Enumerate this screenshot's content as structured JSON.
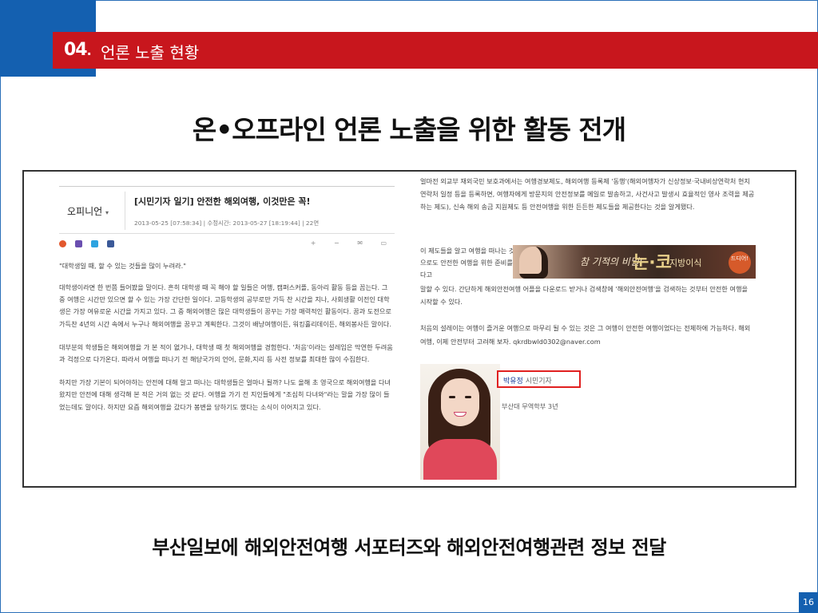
{
  "header": {
    "number": "04",
    "number_dot": ".",
    "title": "언론 노출 현황"
  },
  "main_title": "온•오프라인 언론 노출을 위한 활동 전개",
  "article": {
    "category": "오피니언",
    "category_caret": "▾",
    "title": "[시민기자 일기] 안전한 해외여행, 이것만은 꼭!",
    "meta": "2013-05-25 [07:58:34] | 수정시간: 2013-05-27 [18:19:44] | 22면",
    "tools": "+ − ✉ ▭",
    "quote": "\"대학생일 때, 할 수 있는 것들을 많이 누려라.\"",
    "para1": "대학생이라면 한 번쯤 들어봤을 말이다. 흔히 대학생 때 꼭 해야 할 일들은 여행, 캠퍼스커플, 동아리 활동 등을 꼽는다. 그 중 여행은 시간만 있으면 할 수 있는 가장 간단한 일이다. 고등학생의 공부로만 가득 찬 시간을 지나, 사회생활 이전인 대학생은 가장 여유로운 시간을 가지고 있다. 그 중 해외여행은 많은 대학생들이 꿈꾸는 가장 매력적인 활동이다. 꿈과 도전으로 가득찬 4년의 시간 속에서 누구나 해외여행을 꿈꾸고 계획한다. 그것이 배낭여행이든, 워킹홀리데이든, 해외봉사든 말이다.",
    "para2": "대부분의 학생들은 해외여행을 가 본 적이 없거나, 대학생 때 첫 해외여행을 경험한다. '처음'이라는 설레임은 막연한 두려움과 걱정으로 다가온다. 따라서 여행을 떠나기 전 해당국가의 언어, 문화,지리 등 사전 정보를 최대한 많이 수집한다.",
    "para3": "하지만 가장 기본이 되어야하는 안전에 대해 알고 떠나는 대학생들은 얼마나 될까? 나도 올해 초 영국으로 해외여행을 다녀왔지만 안전에 대해 생각해 본 적은 거의 없는 것 같다. 여행을 가기 전 지인들에게 \"조심히 다녀와\"라는 말을 가장 많이 들었는데도 말이다. 하지만 요즘 해외여행을 갔다가 봉변을 당하기도 했다는 소식이 이어지고 있다."
  },
  "right": {
    "para1": "얼마전 외교부 재외국민 보호과에서는 여행경보제도, 해외여행 등록제 '동행'(해외여행자가 신상정보·국내비상연락처 현지연락처 일정 등을 등록하면, 여행자에게 방문지의 안전정보를 메일로 발송하고, 사건사고 발생시 효율적인 영사 조력을 제공하는 제도), 신속 해외 송금 지원제도 등 안전여행을 위한 든든한 제도들을 제공한다는 것을 알게됐다.",
    "short": "이 제도들을 알고 여행을 떠나는 것만으로도 안전한 여행을 위한 준비를 했다고",
    "para2": "말할 수 있다. 간단하게 해외안전여행 어플을 다운로드 받거나 검색창에 '해외안전여행'을 검색하는 것부터 안전한 여행을 시작할 수 있다.",
    "para3": "처음의 설레이는 여행이 즐거운 여행으로 마무리 될 수 있는 것은 그 여행이 안전한 여행이었다는 전제하에 가능하다. 해외여행, 이제 안전부터 고려해 보자. qkrdbwld0302@naver.com",
    "banner": {
      "script": "참 기적의 비밀!",
      "big": "눈·코",
      "caption": "지방이식",
      "seal": "드디어!"
    },
    "author_name": "박유정",
    "author_role": "시민기자",
    "author_sub": "부산대 무역학부 3년"
  },
  "bottom_text": "부산일보에 해외안전여행 서포터즈와 해외안전여행관련 정보 전달",
  "page_number": "16",
  "colors": {
    "header_red": "#c8161d",
    "corner_blue": "#1460b0",
    "link_blue": "#1a3a9a",
    "highlight_red": "#e02020"
  }
}
